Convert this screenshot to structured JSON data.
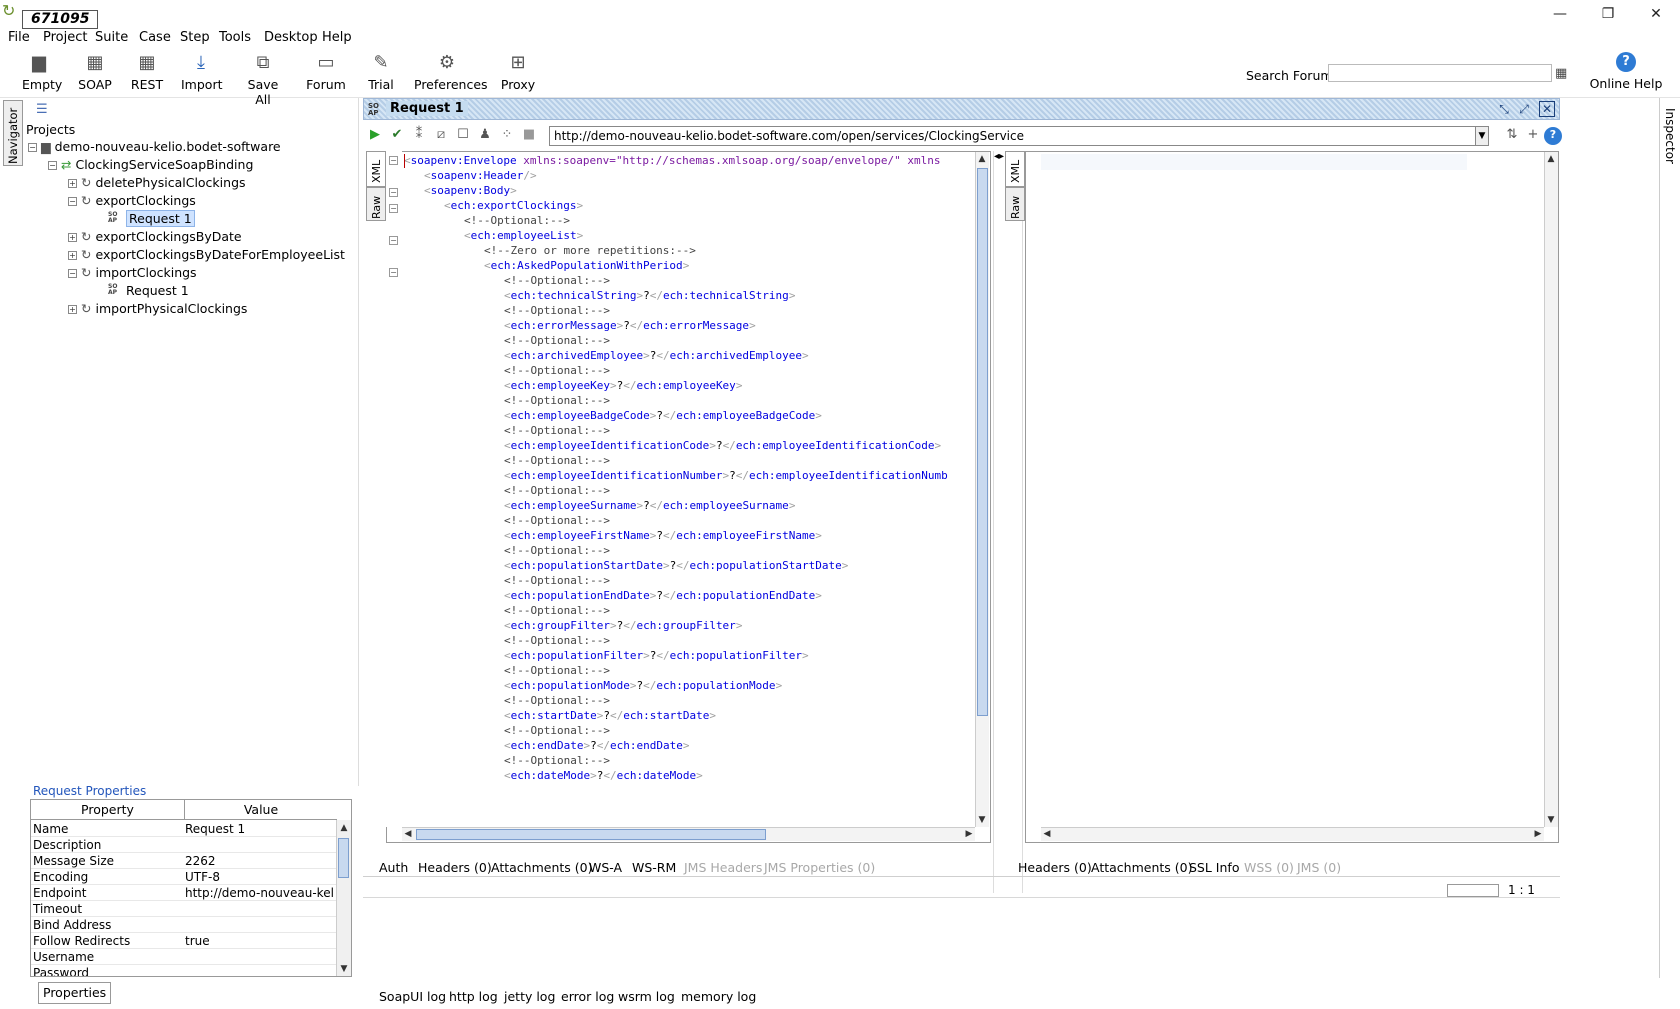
{
  "app": {
    "badge": "671095"
  },
  "window_controls": {
    "minimize": "—",
    "restore": "❐",
    "close": "✕"
  },
  "menu": [
    "File",
    "Project",
    "Suite",
    "Case",
    "Step",
    "Tools",
    "Desktop",
    "Help"
  ],
  "toolbar": {
    "buttons": [
      {
        "label": "Empty",
        "icon": "empty-project-icon"
      },
      {
        "label": "SOAP",
        "icon": "soap-icon"
      },
      {
        "label": "REST",
        "icon": "rest-icon"
      },
      {
        "label": "Import",
        "icon": "import-icon"
      },
      {
        "label": "Save All",
        "icon": "save-all-icon"
      },
      {
        "label": "Forum",
        "icon": "forum-icon"
      },
      {
        "label": "Trial",
        "icon": "trial-icon"
      },
      {
        "label": "Preferences",
        "icon": "gear-icon"
      },
      {
        "label": "Proxy",
        "icon": "proxy-icon"
      }
    ],
    "search_label": "Search Forum",
    "search_value": "",
    "online_help": "Online Help"
  },
  "side_tabs": {
    "navigator": "Navigator",
    "inspector": "Inspector"
  },
  "navigator": {
    "projects_label": "Projects",
    "tree": {
      "project": "demo-nouveau-kelio.bodet-software",
      "binding": "ClockingServiceSoapBinding",
      "op1": "deletePhysicalClockings",
      "op2": "exportClockings",
      "op2_request": "Request 1",
      "op3": "exportClockingsByDate",
      "op4": "exportClockingsByDateForEmployeeList",
      "op5": "importClockings",
      "op5_request": "Request 1",
      "op6": "importPhysicalClockings"
    }
  },
  "properties": {
    "title": "Request Properties",
    "col_property": "Property",
    "col_value": "Value",
    "rows": [
      {
        "name": "Name",
        "value": "Request 1"
      },
      {
        "name": "Description",
        "value": ""
      },
      {
        "name": "Message Size",
        "value": "2262"
      },
      {
        "name": "Encoding",
        "value": "UTF-8"
      },
      {
        "name": "Endpoint",
        "value": "http://demo-nouveau-keli..."
      },
      {
        "name": "Timeout",
        "value": ""
      },
      {
        "name": "Bind Address",
        "value": ""
      },
      {
        "name": "Follow Redirects",
        "value": "true"
      },
      {
        "name": "Username",
        "value": ""
      },
      {
        "name": "Password",
        "value": ""
      }
    ],
    "button": "Properties"
  },
  "editor": {
    "title": "Request 1",
    "endpoint": "http://demo-nouveau-kelio.bodet-software.com/open/services/ClockingService",
    "xml_tab": "XML",
    "raw_tab": "Raw",
    "resp_xml_tab": "XML",
    "resp_raw_tab": "Raw",
    "xml_lines": [
      {
        "indent": 0,
        "kind": "open-attr",
        "tag": "soapenv:Envelope",
        "attr": "xmlns:soapenv",
        "val": "\"http://schemas.xmlsoap.org/soap/envelope/\"",
        "tail": " xmlns"
      },
      {
        "indent": 1,
        "kind": "self",
        "tag": "soapenv:Header"
      },
      {
        "indent": 1,
        "kind": "open",
        "tag": "soapenv:Body"
      },
      {
        "indent": 2,
        "kind": "open",
        "tag": "ech:exportClockings"
      },
      {
        "indent": 3,
        "kind": "comment",
        "text": "<!--Optional:-->"
      },
      {
        "indent": 3,
        "kind": "open",
        "tag": "ech:employeeList"
      },
      {
        "indent": 4,
        "kind": "comment",
        "text": "<!--Zero or more repetitions:-->"
      },
      {
        "indent": 4,
        "kind": "open",
        "tag": "ech:AskedPopulationWithPeriod"
      },
      {
        "indent": 5,
        "kind": "comment",
        "text": "<!--Optional:-->"
      },
      {
        "indent": 5,
        "kind": "elem",
        "tag": "ech:technicalString",
        "text": "?"
      },
      {
        "indent": 5,
        "kind": "comment",
        "text": "<!--Optional:-->"
      },
      {
        "indent": 5,
        "kind": "elem",
        "tag": "ech:errorMessage",
        "text": "?"
      },
      {
        "indent": 5,
        "kind": "comment",
        "text": "<!--Optional:-->"
      },
      {
        "indent": 5,
        "kind": "elem",
        "tag": "ech:archivedEmployee",
        "text": "?"
      },
      {
        "indent": 5,
        "kind": "comment",
        "text": "<!--Optional:-->"
      },
      {
        "indent": 5,
        "kind": "elem",
        "tag": "ech:employeeKey",
        "text": "?"
      },
      {
        "indent": 5,
        "kind": "comment",
        "text": "<!--Optional:-->"
      },
      {
        "indent": 5,
        "kind": "elem",
        "tag": "ech:employeeBadgeCode",
        "text": "?"
      },
      {
        "indent": 5,
        "kind": "comment",
        "text": "<!--Optional:-->"
      },
      {
        "indent": 5,
        "kind": "elem",
        "tag": "ech:employeeIdentificationCode",
        "text": "?"
      },
      {
        "indent": 5,
        "kind": "comment",
        "text": "<!--Optional:-->"
      },
      {
        "indent": 5,
        "kind": "elem",
        "tag": "ech:employeeIdentificationNumber",
        "text": "?",
        "close": "ech:employeeIdentificationNumb"
      },
      {
        "indent": 5,
        "kind": "comment",
        "text": "<!--Optional:-->"
      },
      {
        "indent": 5,
        "kind": "elem",
        "tag": "ech:employeeSurname",
        "text": "?"
      },
      {
        "indent": 5,
        "kind": "comment",
        "text": "<!--Optional:-->"
      },
      {
        "indent": 5,
        "kind": "elem",
        "tag": "ech:employeeFirstName",
        "text": "?"
      },
      {
        "indent": 5,
        "kind": "comment",
        "text": "<!--Optional:-->"
      },
      {
        "indent": 5,
        "kind": "elem",
        "tag": "ech:populationStartDate",
        "text": "?"
      },
      {
        "indent": 5,
        "kind": "comment",
        "text": "<!--Optional:-->"
      },
      {
        "indent": 5,
        "kind": "elem",
        "tag": "ech:populationEndDate",
        "text": "?"
      },
      {
        "indent": 5,
        "kind": "comment",
        "text": "<!--Optional:-->"
      },
      {
        "indent": 5,
        "kind": "elem",
        "tag": "ech:groupFilter",
        "text": "?"
      },
      {
        "indent": 5,
        "kind": "comment",
        "text": "<!--Optional:-->"
      },
      {
        "indent": 5,
        "kind": "elem",
        "tag": "ech:populationFilter",
        "text": "?"
      },
      {
        "indent": 5,
        "kind": "comment",
        "text": "<!--Optional:-->"
      },
      {
        "indent": 5,
        "kind": "elem",
        "tag": "ech:populationMode",
        "text": "?"
      },
      {
        "indent": 5,
        "kind": "comment",
        "text": "<!--Optional:-->"
      },
      {
        "indent": 5,
        "kind": "elem",
        "tag": "ech:startDate",
        "text": "?"
      },
      {
        "indent": 5,
        "kind": "comment",
        "text": "<!--Optional:-->"
      },
      {
        "indent": 5,
        "kind": "elem",
        "tag": "ech:endDate",
        "text": "?"
      },
      {
        "indent": 5,
        "kind": "comment",
        "text": "<!--Optional:-->"
      },
      {
        "indent": 5,
        "kind": "elem",
        "tag": "ech:dateMode",
        "text": "?"
      }
    ]
  },
  "request_tabs": [
    {
      "label": "Auth",
      "enabled": true
    },
    {
      "label": "Headers (0)",
      "enabled": true
    },
    {
      "label": "Attachments (0)",
      "enabled": true
    },
    {
      "label": "WS-A",
      "enabled": true
    },
    {
      "label": "WS-RM",
      "enabled": true
    },
    {
      "label": "JMS Headers",
      "enabled": false
    },
    {
      "label": "JMS Properties (0)",
      "enabled": false
    }
  ],
  "response_tabs": [
    {
      "label": "Headers (0)",
      "enabled": true
    },
    {
      "label": "Attachments (0)",
      "enabled": true
    },
    {
      "label": "SSL Info",
      "enabled": true
    },
    {
      "label": "WSS (0)",
      "enabled": false
    },
    {
      "label": "JMS (0)",
      "enabled": false
    }
  ],
  "zoom": "1 : 1",
  "log_tabs": [
    "SoapUI log",
    "http log",
    "jetty log",
    "error log",
    "wsrm log",
    "memory log"
  ]
}
